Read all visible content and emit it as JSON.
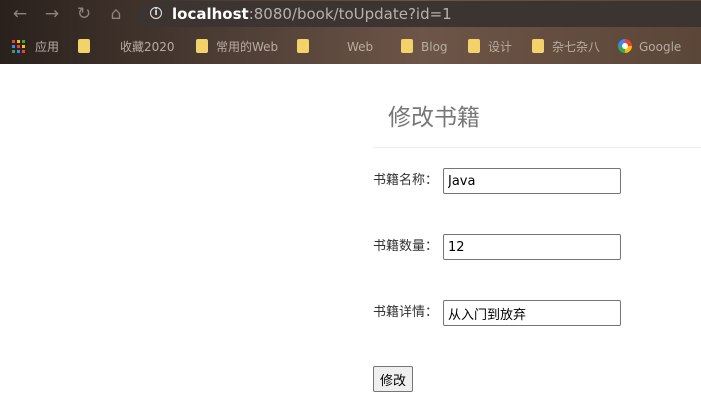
{
  "browser": {
    "url_host": "localhost",
    "url_rest": ":8080/book/toUpdate?id=1",
    "bookmarks": [
      {
        "label": "应用",
        "icon": "apps-grid-icon"
      },
      {
        "label": "收藏2020",
        "icon": "folder-icon"
      },
      {
        "label": "常用的Web",
        "icon": "folder-icon"
      },
      {
        "label": "Web",
        "icon": "folder-icon"
      },
      {
        "label": "Blog",
        "icon": "folder-icon"
      },
      {
        "label": "设计",
        "icon": "folder-icon"
      },
      {
        "label": "杂七杂八",
        "icon": "folder-icon"
      },
      {
        "label": "Google",
        "icon": "google-icon"
      }
    ]
  },
  "page": {
    "title": "修改书籍"
  },
  "form": {
    "name_label": "书籍名称：",
    "name_value": "Java",
    "count_label": "书籍数量：",
    "count_value": "12",
    "detail_label": "书籍详情：",
    "detail_value": "从入门到放弃",
    "submit_label": "修改"
  }
}
